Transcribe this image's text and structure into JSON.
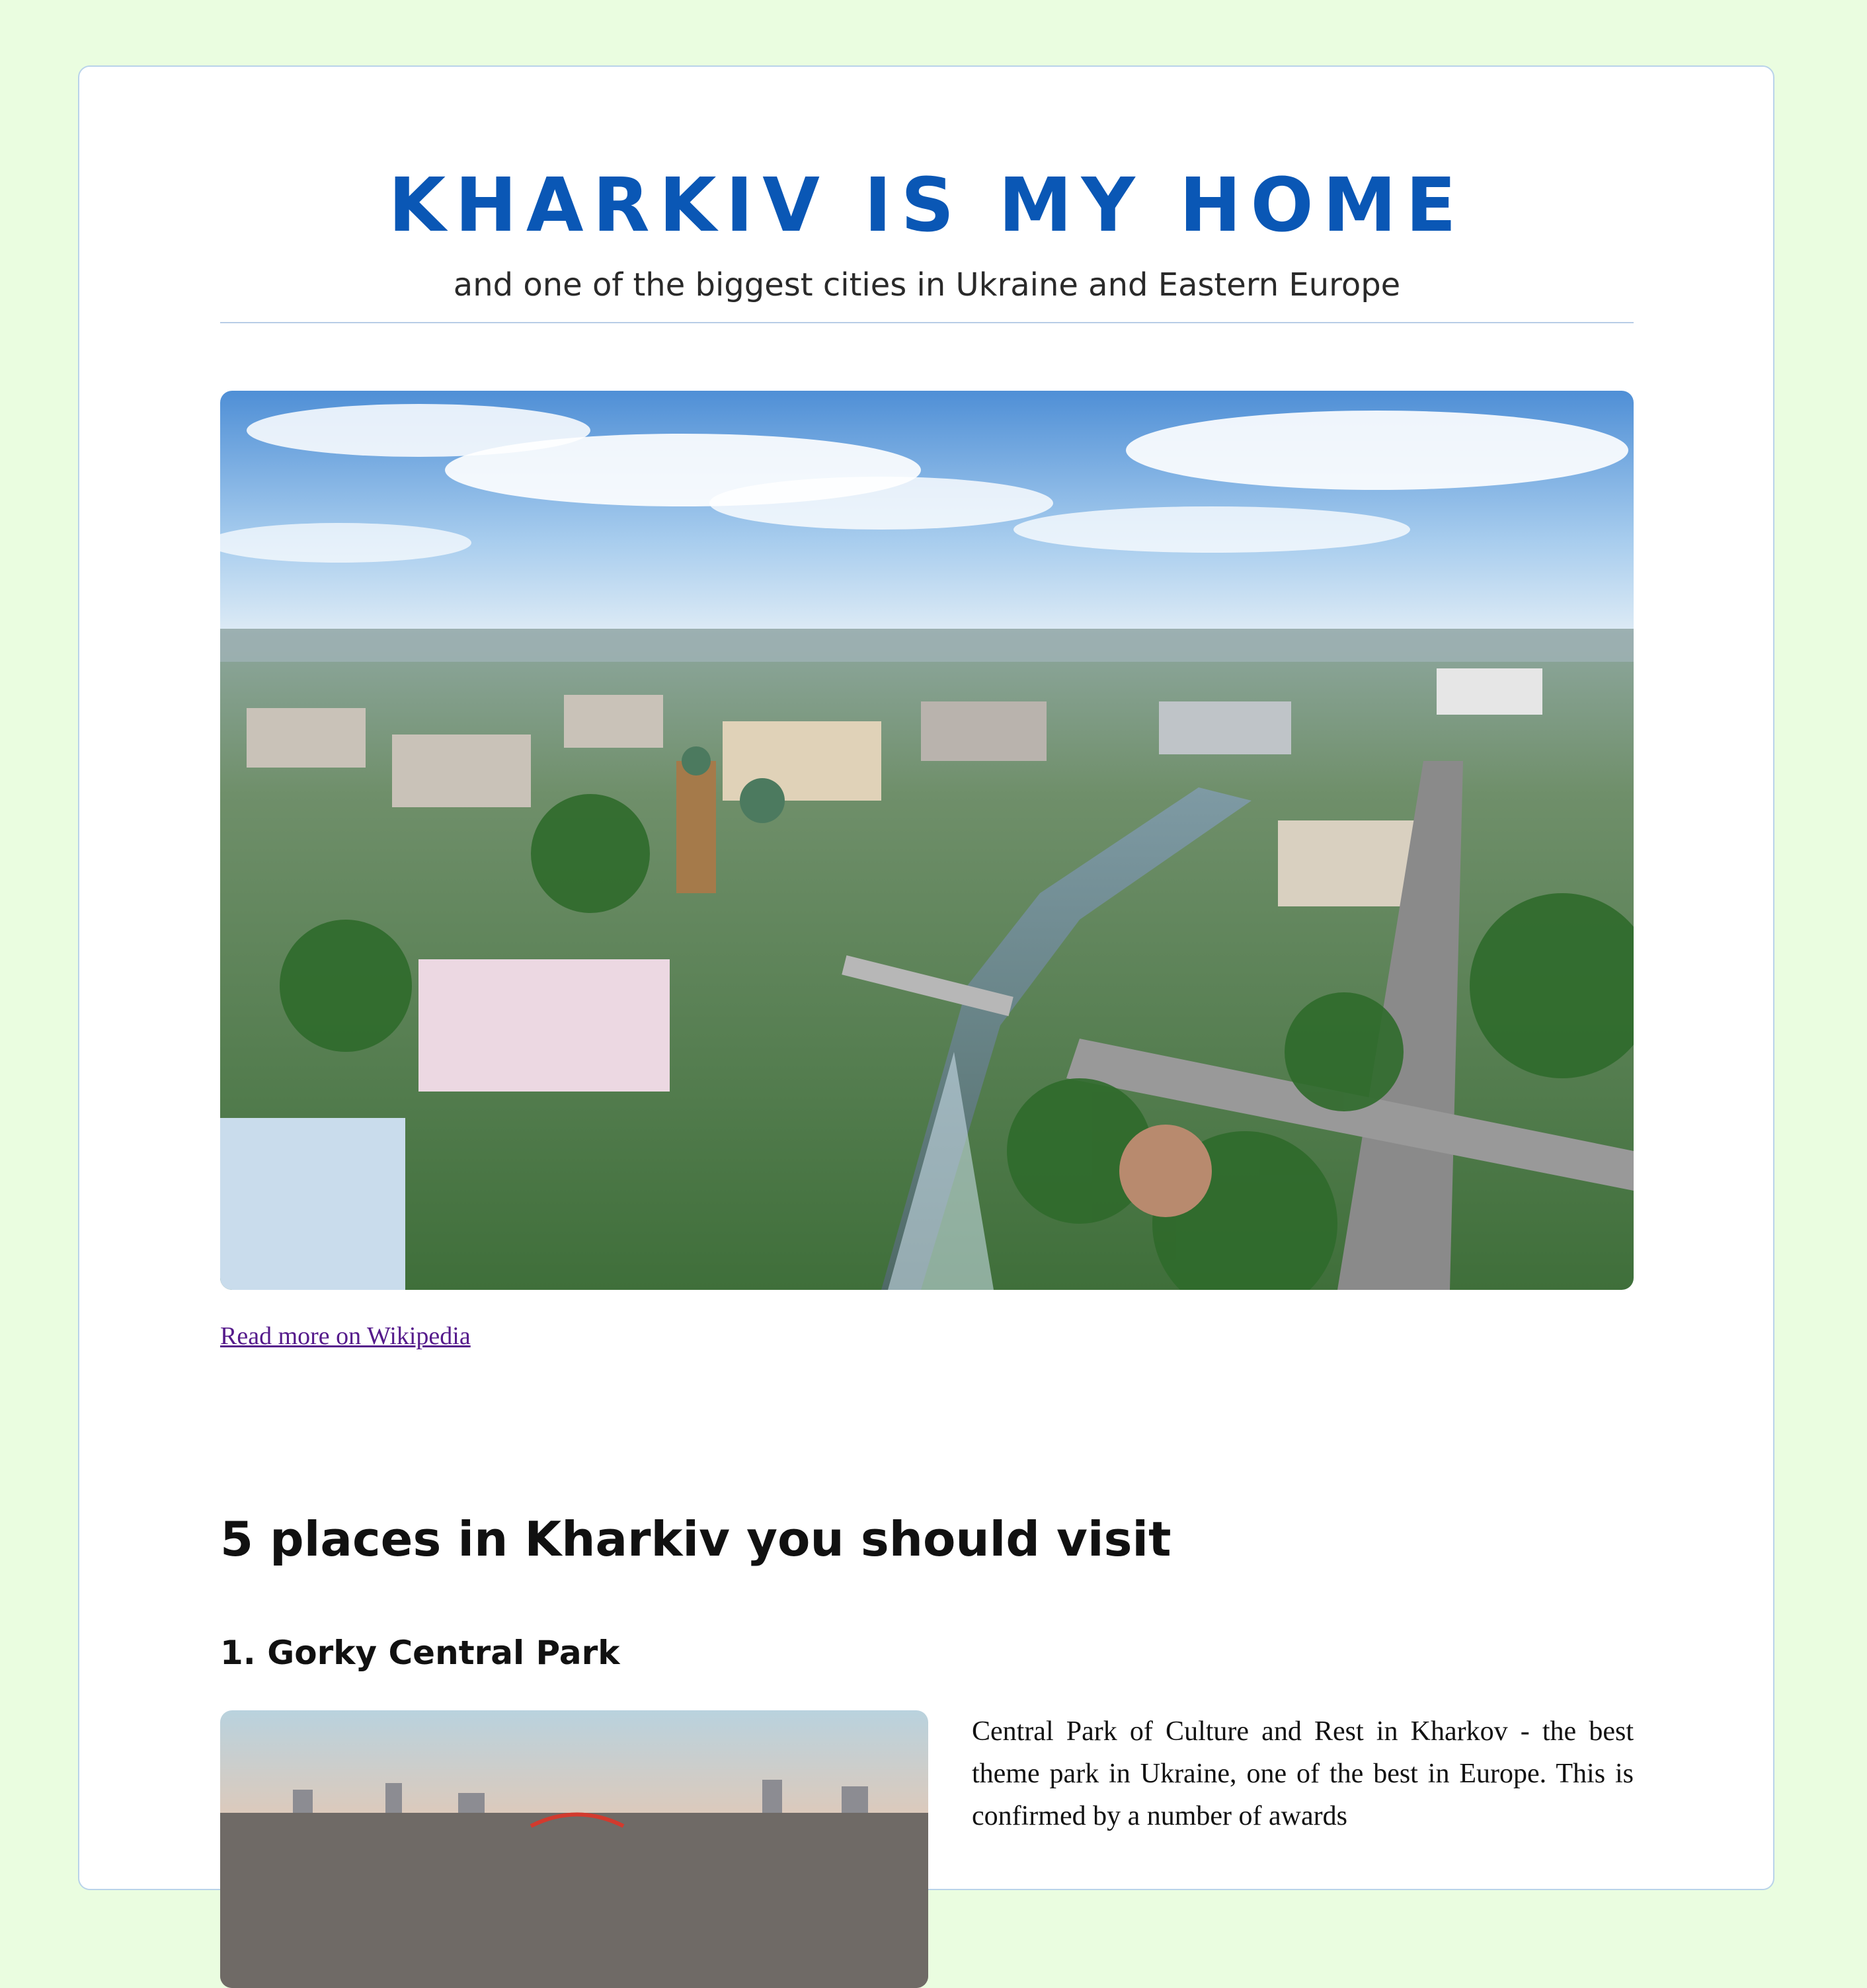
{
  "header": {
    "title": "KHARKIV IS MY HOME",
    "subtitle": "and one of the biggest cities in Ukraine and Eastern Europe"
  },
  "hero": {
    "alt": "Aerial view of Kharkiv"
  },
  "links": {
    "wikipedia": "Read more on Wikipedia"
  },
  "section": {
    "title": "5 places in Kharkiv you should visit"
  },
  "places": [
    {
      "title": "1. Gorky Central Park",
      "alt": "Gorky Central Park",
      "text": "Central Park of Culture and Rest in Kharkov - the best theme park in Ukraine, one of the best in Europe. This is confirmed by a number of awards"
    }
  ],
  "colors": {
    "page_background": "#eafde0",
    "card_background": "#ffffff",
    "title_blue": "#0a57b5",
    "link_visited": "#551a8b"
  }
}
